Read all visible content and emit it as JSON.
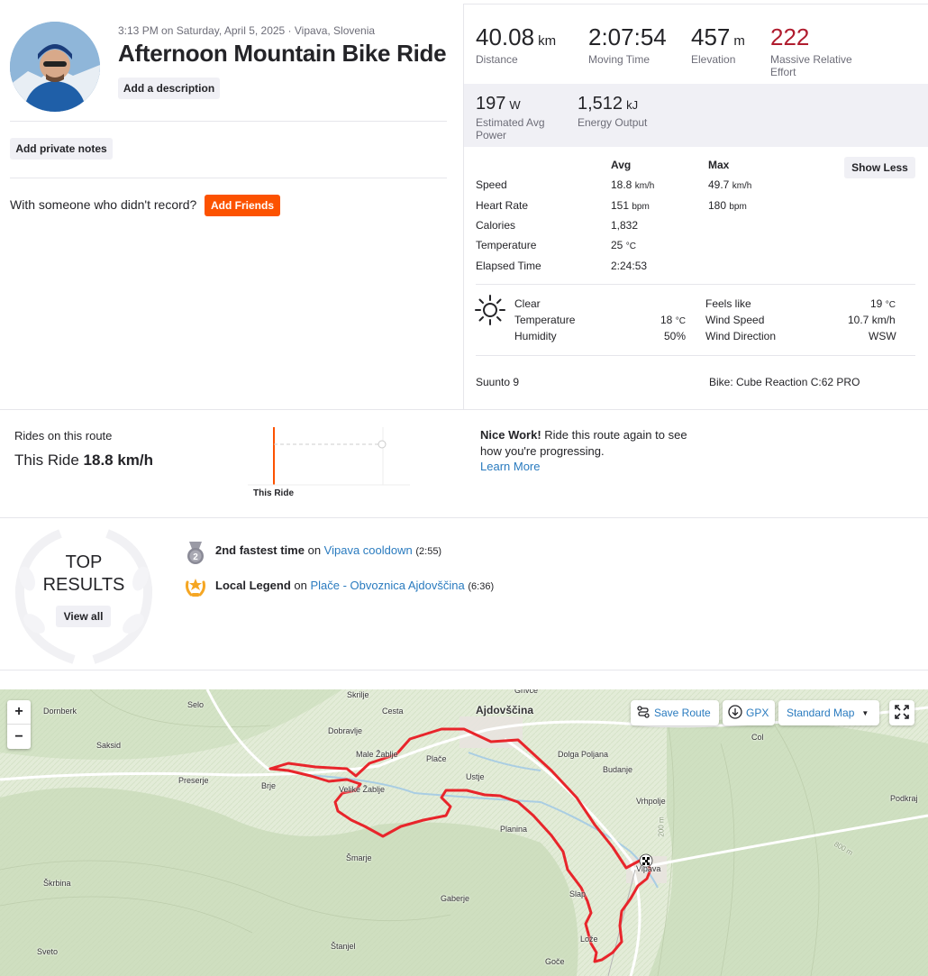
{
  "activity": {
    "datetime": "3:13 PM on Saturday, April 5, 2025 · Vipava, Slovenia",
    "title": "Afternoon Mountain Bike Ride",
    "add_description": "Add a description",
    "add_private_notes": "Add private notes",
    "with_someone": "With someone who didn't record?",
    "add_friends": "Add Friends"
  },
  "stats": {
    "distance": {
      "value": "40.08",
      "unit": "km",
      "label": "Distance"
    },
    "moving_time": {
      "value": "2:07:54",
      "label": "Moving Time"
    },
    "elevation": {
      "value": "457",
      "unit": "m",
      "label": "Elevation"
    },
    "relative_effort": {
      "value": "222",
      "label": "Massive Relative Effort",
      "color": "#b01c2e"
    },
    "power": {
      "value": "197",
      "unit": "W",
      "label": "Estimated Avg Power"
    },
    "energy": {
      "value": "1,512",
      "unit": "kJ",
      "label": "Energy Output"
    }
  },
  "details": {
    "avg_header": "Avg",
    "max_header": "Max",
    "show_less": "Show Less",
    "rows": [
      {
        "label": "Speed",
        "avg": "18.8",
        "avg_unit": "km/h",
        "max": "49.7",
        "max_unit": "km/h"
      },
      {
        "label": "Heart Rate",
        "avg": "151",
        "avg_unit": "bpm",
        "max": "180",
        "max_unit": "bpm"
      },
      {
        "label": "Calories",
        "avg": "1,832",
        "avg_unit": "",
        "max": "",
        "max_unit": ""
      },
      {
        "label": "Temperature",
        "avg": "25",
        "avg_unit": "°C",
        "max": "",
        "max_unit": ""
      },
      {
        "label": "Elapsed Time",
        "avg": "2:24:53",
        "avg_unit": "",
        "max": "",
        "max_unit": ""
      }
    ]
  },
  "weather": {
    "condition": "Clear",
    "temperature_label": "Temperature",
    "temperature": "18",
    "temperature_unit": "°C",
    "humidity_label": "Humidity",
    "humidity": "50%",
    "feels_like_label": "Feels like",
    "feels_like": "19",
    "feels_like_unit": "°C",
    "wind_speed_label": "Wind Speed",
    "wind_speed": "10.7 km/h",
    "wind_direction_label": "Wind Direction",
    "wind_direction": "WSW"
  },
  "gear": {
    "device": "Suunto 9",
    "bike": "Bike: Cube Reaction C:62 PRO"
  },
  "route": {
    "title": "Rides on this route",
    "this_ride_label": "This Ride",
    "this_ride_value": "18.8 km/h",
    "chart_label": "This Ride",
    "nice_work_bold": "Nice Work!",
    "nice_work_text": " Ride this route again to see how you're progressing.",
    "learn_more": "Learn More"
  },
  "top_results": {
    "title_line1": "TOP",
    "title_line2": "RESULTS",
    "view_all": "View all",
    "items": [
      {
        "icon": "silver-medal-icon",
        "badge": "2",
        "bold": "2nd fastest time",
        "on": " on ",
        "segment": "Vipava cooldown",
        "time": "(2:55)"
      },
      {
        "icon": "local-legend-laurel-icon",
        "badge": "",
        "bold": "Local Legend",
        "on": " on ",
        "segment": "Plače - Obvoznica Ajdovščina",
        "time": "(6:36)"
      }
    ]
  },
  "map": {
    "zoom_in": "+",
    "zoom_out": "−",
    "save_route": "Save Route",
    "gpx": "GPX",
    "map_type": "Standard Map",
    "places": [
      "Skrilje",
      "Grivče",
      "Selo",
      "Cesta",
      "Ajdovščina",
      "Dornberk",
      "Dobravlje",
      "Col",
      "Male Žablje",
      "Plače",
      "Dolga Poljana",
      "Saksid",
      "Budanje",
      "Ustje",
      "Preserje",
      "Brje",
      "Velike Žablje",
      "Vrhpolje",
      "Podkraj",
      "Planina",
      "Šmarje",
      "Vipava",
      "Škrbina",
      "Gaberje",
      "Slap",
      "Lože",
      "Sveto",
      "Štanjel",
      "Goče"
    ],
    "contours": [
      "200 m",
      "800 m"
    ],
    "route_color": "#e8252b"
  }
}
